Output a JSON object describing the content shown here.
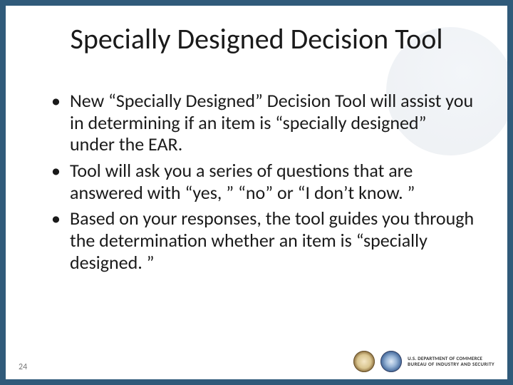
{
  "slide": {
    "title": "Specially Designed Decision Tool",
    "bullets": [
      "New “Specially Designed” Decision Tool will assist you in determining if an item is “specially designed” under the EAR.",
      "Tool will ask you a series of questions that are answered with “yes, ” “no” or “I don’t know. ”",
      "Based on your responses, the tool guides you through the determination whether an item is “specially designed. ”"
    ],
    "page_number": "24",
    "footer": {
      "line1": "U.S. DEPARTMENT OF COMMERCE",
      "line2": "BUREAU OF INDUSTRY AND SECURITY"
    }
  }
}
